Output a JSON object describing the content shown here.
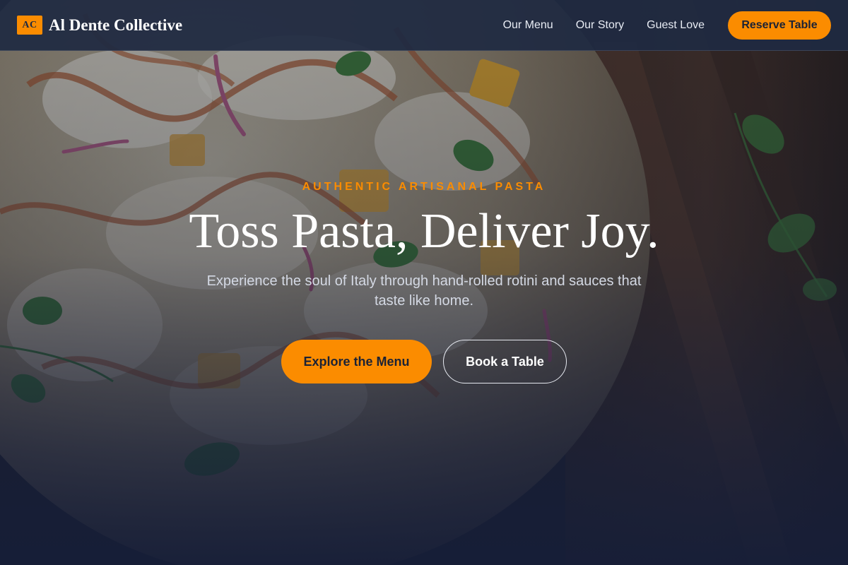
{
  "brand": {
    "logo_text": "AC",
    "name": "Al Dente Collective"
  },
  "nav": {
    "links": [
      "Our Menu",
      "Our Story",
      "Guest Love"
    ],
    "reserve_label": "Reserve Table"
  },
  "hero": {
    "eyebrow": "AUTHENTIC ARTISANAL PASTA",
    "headline": "Toss Pasta, Deliver Joy.",
    "subtext": "Experience the soul of Italy through hand-rolled rotini and sauces that taste like home.",
    "primary_cta": "Explore the Menu",
    "secondary_cta": "Book a Table",
    "background_image": "pizza-on-wooden-board"
  },
  "colors": {
    "accent": "#fb8c00",
    "navbar": "#1f2a42",
    "hero_overlay": "#16203a",
    "text_light": "#ffffff"
  }
}
